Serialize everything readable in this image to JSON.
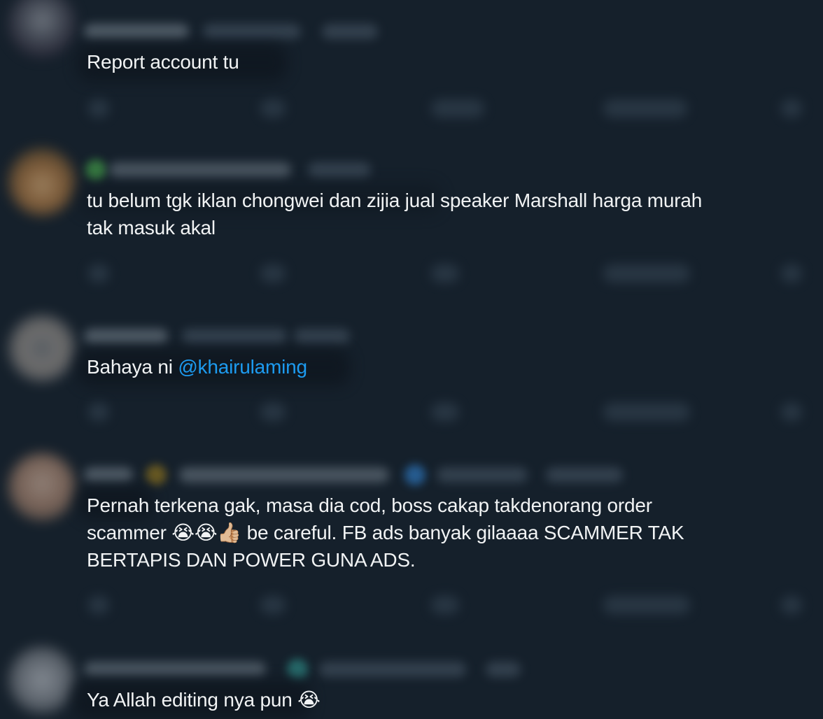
{
  "colors": {
    "background": "#15202b",
    "text": "#f1f3f4",
    "mention": "#1d9bf0"
  },
  "tweets": [
    {
      "lines": [
        "Report account tu"
      ]
    },
    {
      "lines": [
        "tu belum tgk iklan chongwei dan zijia jual speaker Marshall harga murah",
        "tak masuk akal"
      ]
    },
    {
      "text_before_mention": "Bahaya ni ",
      "mention": "@khairulaming"
    },
    {
      "line1": "Pernah terkena gak, masa dia cod, boss cakap takdenorang order",
      "line2_prefix": "scammer ",
      "line2_emojis": "😭😭👍🏼",
      "line2_suffix": " be careful. FB ads banyak gilaaaa SCAMMER TAK",
      "line3": "BERTAPIS DAN POWER GUNA ADS."
    },
    {
      "text": "Ya Allah editing nya pun ",
      "emoji": "😭"
    }
  ],
  "icons": {
    "avatar": "avatar",
    "reply": "reply-icon",
    "retweet": "retweet-icon",
    "like": "like-icon",
    "views": "views-icon",
    "share": "share-icon"
  }
}
